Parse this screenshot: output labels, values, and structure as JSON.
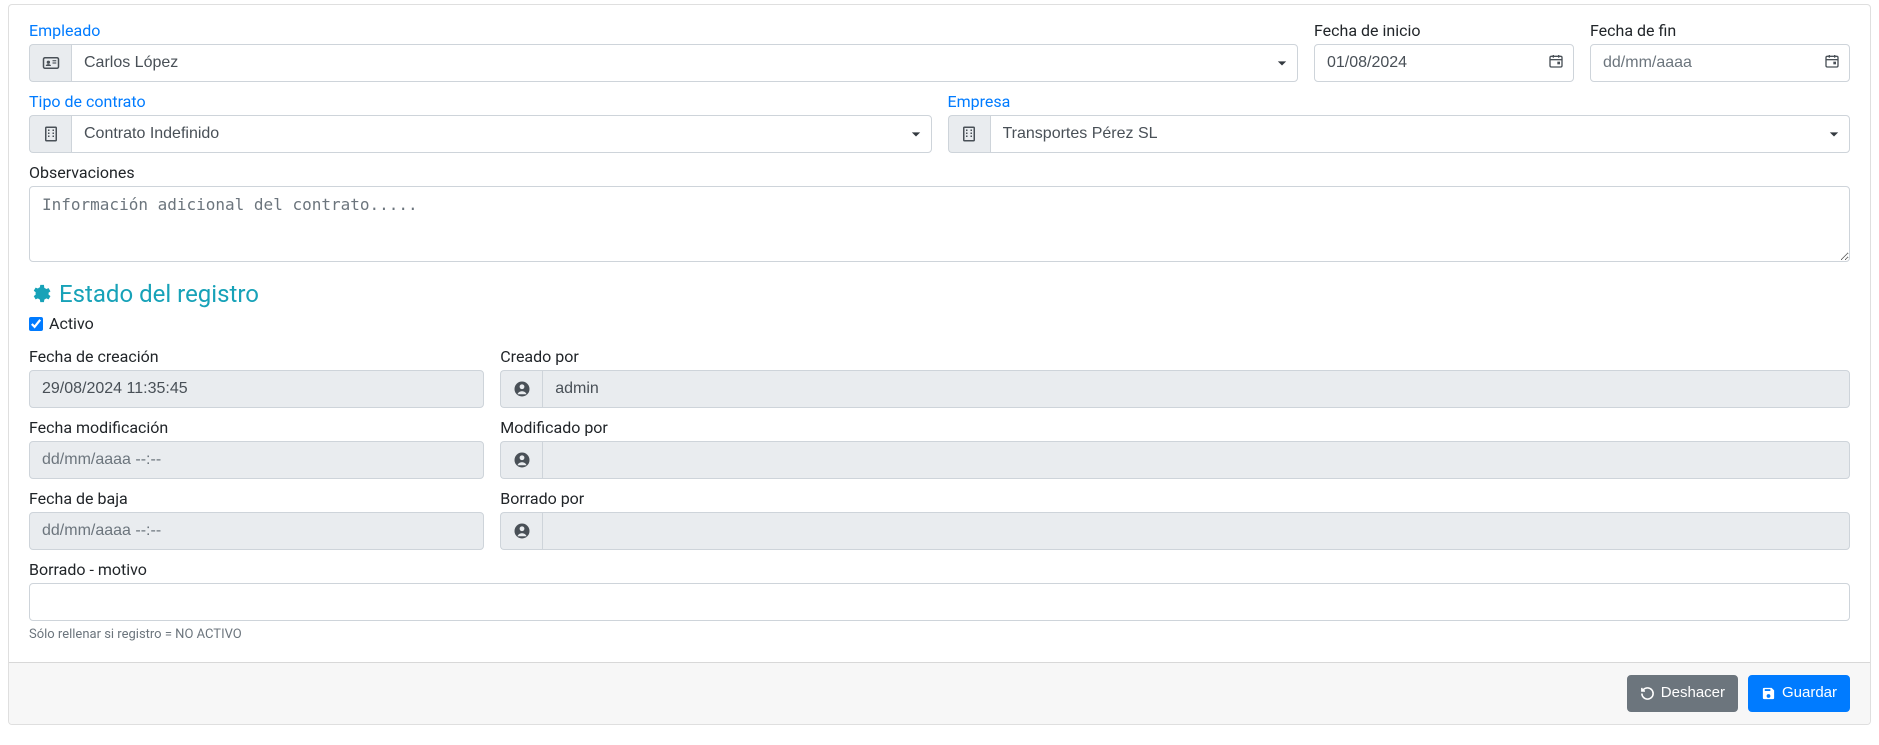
{
  "labels": {
    "empleado": "Empleado",
    "fecha_inicio": "Fecha de inicio",
    "fecha_fin": "Fecha de fin",
    "tipo_contrato": "Tipo de contrato",
    "empresa": "Empresa",
    "observaciones": "Observaciones",
    "estado_registro": "Estado del registro",
    "activo": "Activo",
    "fecha_creacion": "Fecha de creación",
    "creado_por": "Creado por",
    "fecha_modificacion": "Fecha modificación",
    "modificado_por": "Modificado por",
    "fecha_baja": "Fecha de baja",
    "borrado_por": "Borrado por",
    "borrado_motivo": "Borrado - motivo",
    "help_borrado": "Sólo rellenar si registro = NO ACTIVO"
  },
  "values": {
    "empleado": "Carlos López",
    "fecha_inicio": "01/08/2024",
    "fecha_fin_placeholder": "dd/mm/aaaa",
    "tipo_contrato": "Contrato Indefinido",
    "empresa": "Transportes Pérez SL",
    "observaciones_placeholder": "Información adicional del contrato.....",
    "activo_checked": true,
    "fecha_creacion": "29/08/2024 11:35:45",
    "creado_por": "admin",
    "fecha_modificacion_placeholder": "dd/mm/aaaa --:--",
    "modificado_por": "",
    "fecha_baja_placeholder": "dd/mm/aaaa --:--",
    "borrado_por": "",
    "borrado_motivo": ""
  },
  "buttons": {
    "deshacer": "Deshacer",
    "guardar": "Guardar"
  }
}
